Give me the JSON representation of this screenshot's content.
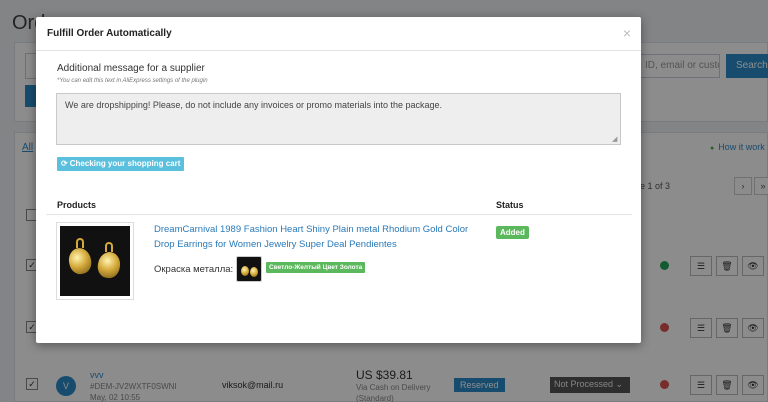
{
  "background": {
    "page_title": "Ord",
    "search_placeholder": "ID, email or custo",
    "search_button": "Search",
    "all_link": "All",
    "how_it_works": "How it work",
    "pager_text": "e 1 of 3",
    "pager_next": "›",
    "pager_last": "»",
    "order": {
      "avatar_letter": "V",
      "customer_name": "vvv",
      "order_id": "#DEM-JV2WXTF0SWNI",
      "date": "May, 02 10:55",
      "email": "viksok@mail.ru",
      "price": "US $39.81",
      "payment": "Via Cash on Delivery",
      "shipping": "(Standard)",
      "reserved_badge": "Reserved",
      "processing_status": "Not Processed"
    },
    "colors": {
      "accent": "#2a8bc9",
      "dot_green": "#27a35a",
      "dot_red": "#d9534f"
    }
  },
  "modal": {
    "title": "Fulfill Order Automatically",
    "close_glyph": "×",
    "message_label": "Additional message for a supplier",
    "message_hint": "*You can edit this text in AliExpress settings of the plugin",
    "message_value": "We are dropshipping! Please, do not include any invoices or promo materials into the package.",
    "check_button": "Checking your shopping cart",
    "table": {
      "col_products": "Products",
      "col_status": "Status"
    },
    "product": {
      "title": "DreamCarnival 1989 Fashion Heart Shiny Plain metal Rhodium Gold Color Drop Earrings for Women Jewelry Super Deal Pendientes",
      "variant_label": "Окраска металла:",
      "variant_value": "Светло-Желтый Цвет Золота",
      "status": "Added"
    },
    "colors": {
      "info": "#5bc0de",
      "success": "#5cb85c",
      "link": "#2a7ab8"
    }
  }
}
